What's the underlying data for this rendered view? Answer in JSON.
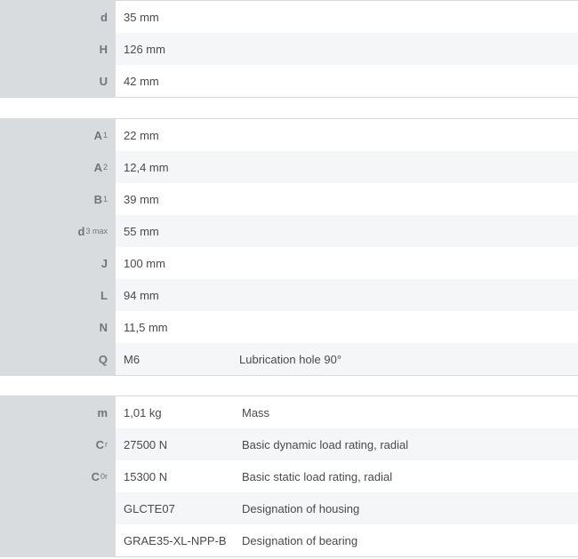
{
  "groups": [
    {
      "rows": [
        {
          "symbol": "d",
          "sub": "",
          "value": "35  mm",
          "description": ""
        },
        {
          "symbol": "H",
          "sub": "",
          "value": "126  mm",
          "description": ""
        },
        {
          "symbol": "U",
          "sub": "",
          "value": "42  mm",
          "description": ""
        }
      ]
    },
    {
      "rows": [
        {
          "symbol": "A",
          "sub": "1",
          "value": "22  mm",
          "description": ""
        },
        {
          "symbol": "A",
          "sub": "2",
          "value": "12,4  mm",
          "description": ""
        },
        {
          "symbol": "B",
          "sub": "1",
          "value": "39  mm",
          "description": ""
        },
        {
          "symbol": "d",
          "sub": "3 max",
          "value": "55  mm",
          "description": ""
        },
        {
          "symbol": "J",
          "sub": "",
          "value": "100  mm",
          "description": ""
        },
        {
          "symbol": "L",
          "sub": "",
          "value": "94  mm",
          "description": ""
        },
        {
          "symbol": "N",
          "sub": "",
          "value": "11,5  mm",
          "description": ""
        },
        {
          "symbol": "Q",
          "sub": "",
          "value": "M6",
          "description": "Lubrication hole 90°"
        }
      ]
    },
    {
      "rows": [
        {
          "symbol": "m",
          "sub": "",
          "value": "1,01  kg",
          "description": "Mass"
        },
        {
          "symbol": "C",
          "sub": "r",
          "value": "27500  N",
          "description": "Basic dynamic load rating, radial"
        },
        {
          "symbol": "C",
          "sub": "0r",
          "value": "15300  N",
          "description": "Basic static load rating, radial"
        },
        {
          "symbol": "",
          "sub": "",
          "value": "GLCTE07",
          "description": "Designation of housing"
        },
        {
          "symbol": "",
          "sub": "",
          "value": "GRAE35-XL-NPP-B",
          "description": "Designation of bearing"
        }
      ]
    }
  ]
}
